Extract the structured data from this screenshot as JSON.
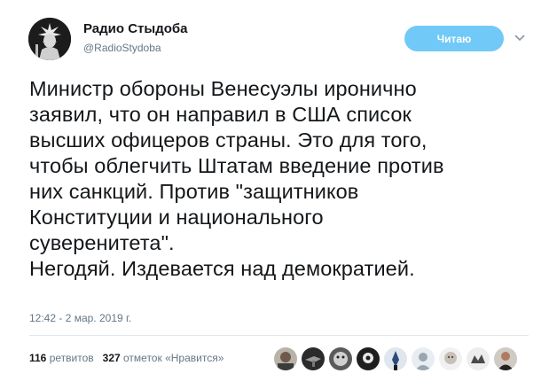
{
  "author": {
    "name": "Радио Стыдоба",
    "handle": "@RadioStydoba"
  },
  "follow_button": {
    "label": "Читаю"
  },
  "tweet": {
    "text": "Министр обороны Венесуэлы иронично\nзаявил, что он направил в США список\nвысших офицеров страны. Это для того,\nчтобы облегчить Штатам введение против\nних санкций. Против \"защитников\nКонституции и национального\nсуверенитета\".\nНегодяй. Издевается над демократией.",
    "timestamp": "12:42 - 2 мар. 2019 г."
  },
  "stats": {
    "retweets_count": "116",
    "retweets_label": "ретвитов",
    "likes_count": "327",
    "likes_label": "отметок «Нравится»"
  },
  "likers": [
    "avatar-1",
    "avatar-2",
    "avatar-3",
    "avatar-4",
    "avatar-5",
    "avatar-6",
    "avatar-7",
    "avatar-8",
    "avatar-9"
  ],
  "colors": {
    "follow_button": "#71c9f8",
    "secondary_text": "#657786",
    "primary_text": "#14171a",
    "divider": "#e1e8ed"
  }
}
